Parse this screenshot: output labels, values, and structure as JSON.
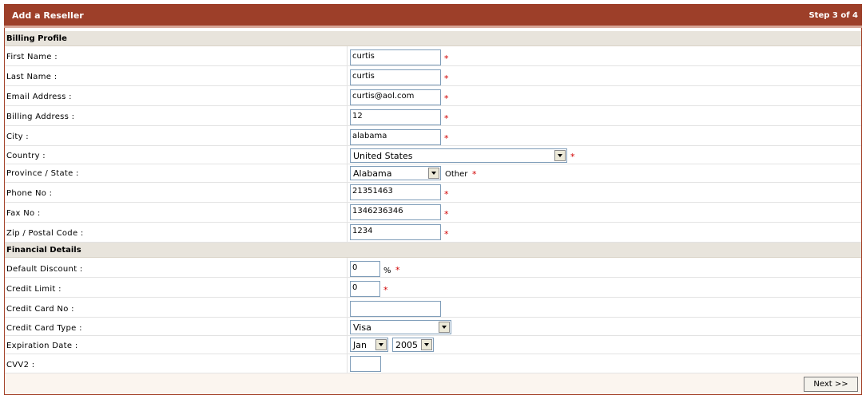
{
  "header": {
    "title": "Add a Reseller",
    "step": "Step 3 of 4"
  },
  "billing": {
    "section_title": "Billing Profile",
    "first_name": {
      "label": "First Name :",
      "value": "curtis",
      "required": "*"
    },
    "last_name": {
      "label": "Last Name :",
      "value": "curtis",
      "required": "*"
    },
    "email": {
      "label": "Email Address :",
      "value": "curtis@aol.com",
      "required": "*"
    },
    "address": {
      "label": "Billing Address :",
      "value": "12",
      "required": "*"
    },
    "city": {
      "label": "City :",
      "value": "alabama",
      "required": "*"
    },
    "country": {
      "label": "Country :",
      "value": "United States",
      "required": "*"
    },
    "state": {
      "label": "Province / State :",
      "value": "Alabama",
      "other_label": "Other",
      "required": "*"
    },
    "phone": {
      "label": "Phone No :",
      "value": "21351463",
      "required": "*"
    },
    "fax": {
      "label": "Fax No :",
      "value": "1346236346",
      "required": "*"
    },
    "zip": {
      "label": "Zip / Postal Code :",
      "value": "1234",
      "required": "*"
    }
  },
  "financial": {
    "section_title": "Financial Details",
    "discount": {
      "label": "Default Discount :",
      "value": "0",
      "unit": "%",
      "required": "*"
    },
    "credit_limit": {
      "label": "Credit Limit :",
      "value": "0",
      "required": "*"
    },
    "card_no": {
      "label": "Credit Card No :",
      "value": ""
    },
    "card_type": {
      "label": "Credit Card Type :",
      "value": "Visa"
    },
    "expiration": {
      "label": "Expiration Date :",
      "month": "Jan",
      "year": "2005"
    },
    "cvv2": {
      "label": "CVV2 :",
      "value": ""
    }
  },
  "actions": {
    "next_label": "Next >>"
  },
  "colors": {
    "header_bg": "#9d3f29",
    "section_bg": "#e8e4dc",
    "required": "#d10000"
  }
}
